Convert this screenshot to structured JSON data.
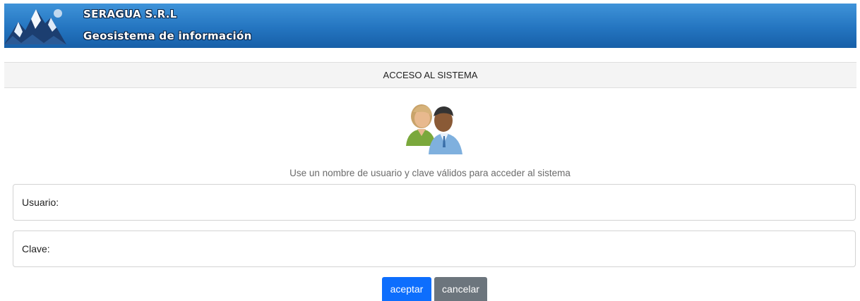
{
  "header": {
    "logo": "mountain-logo-icon",
    "title": "SERAGUA S.R.L",
    "subtitle": "Geosistema de información"
  },
  "access_bar": {
    "label": "ACCESO AL SISTEMA"
  },
  "users_icon": "users-icon",
  "help_text": "Use un nombre de usuario y clave válidos para acceder al sistema",
  "form": {
    "username_label": "Usuario:",
    "username_value": "",
    "password_label": "Clave:",
    "password_value": ""
  },
  "buttons": {
    "accept_label": "aceptar",
    "cancel_label": "cancelar"
  },
  "colors": {
    "header_blue": "#2475c0",
    "accept_blue": "#0d6efd",
    "cancel_gray": "#6c757d"
  }
}
